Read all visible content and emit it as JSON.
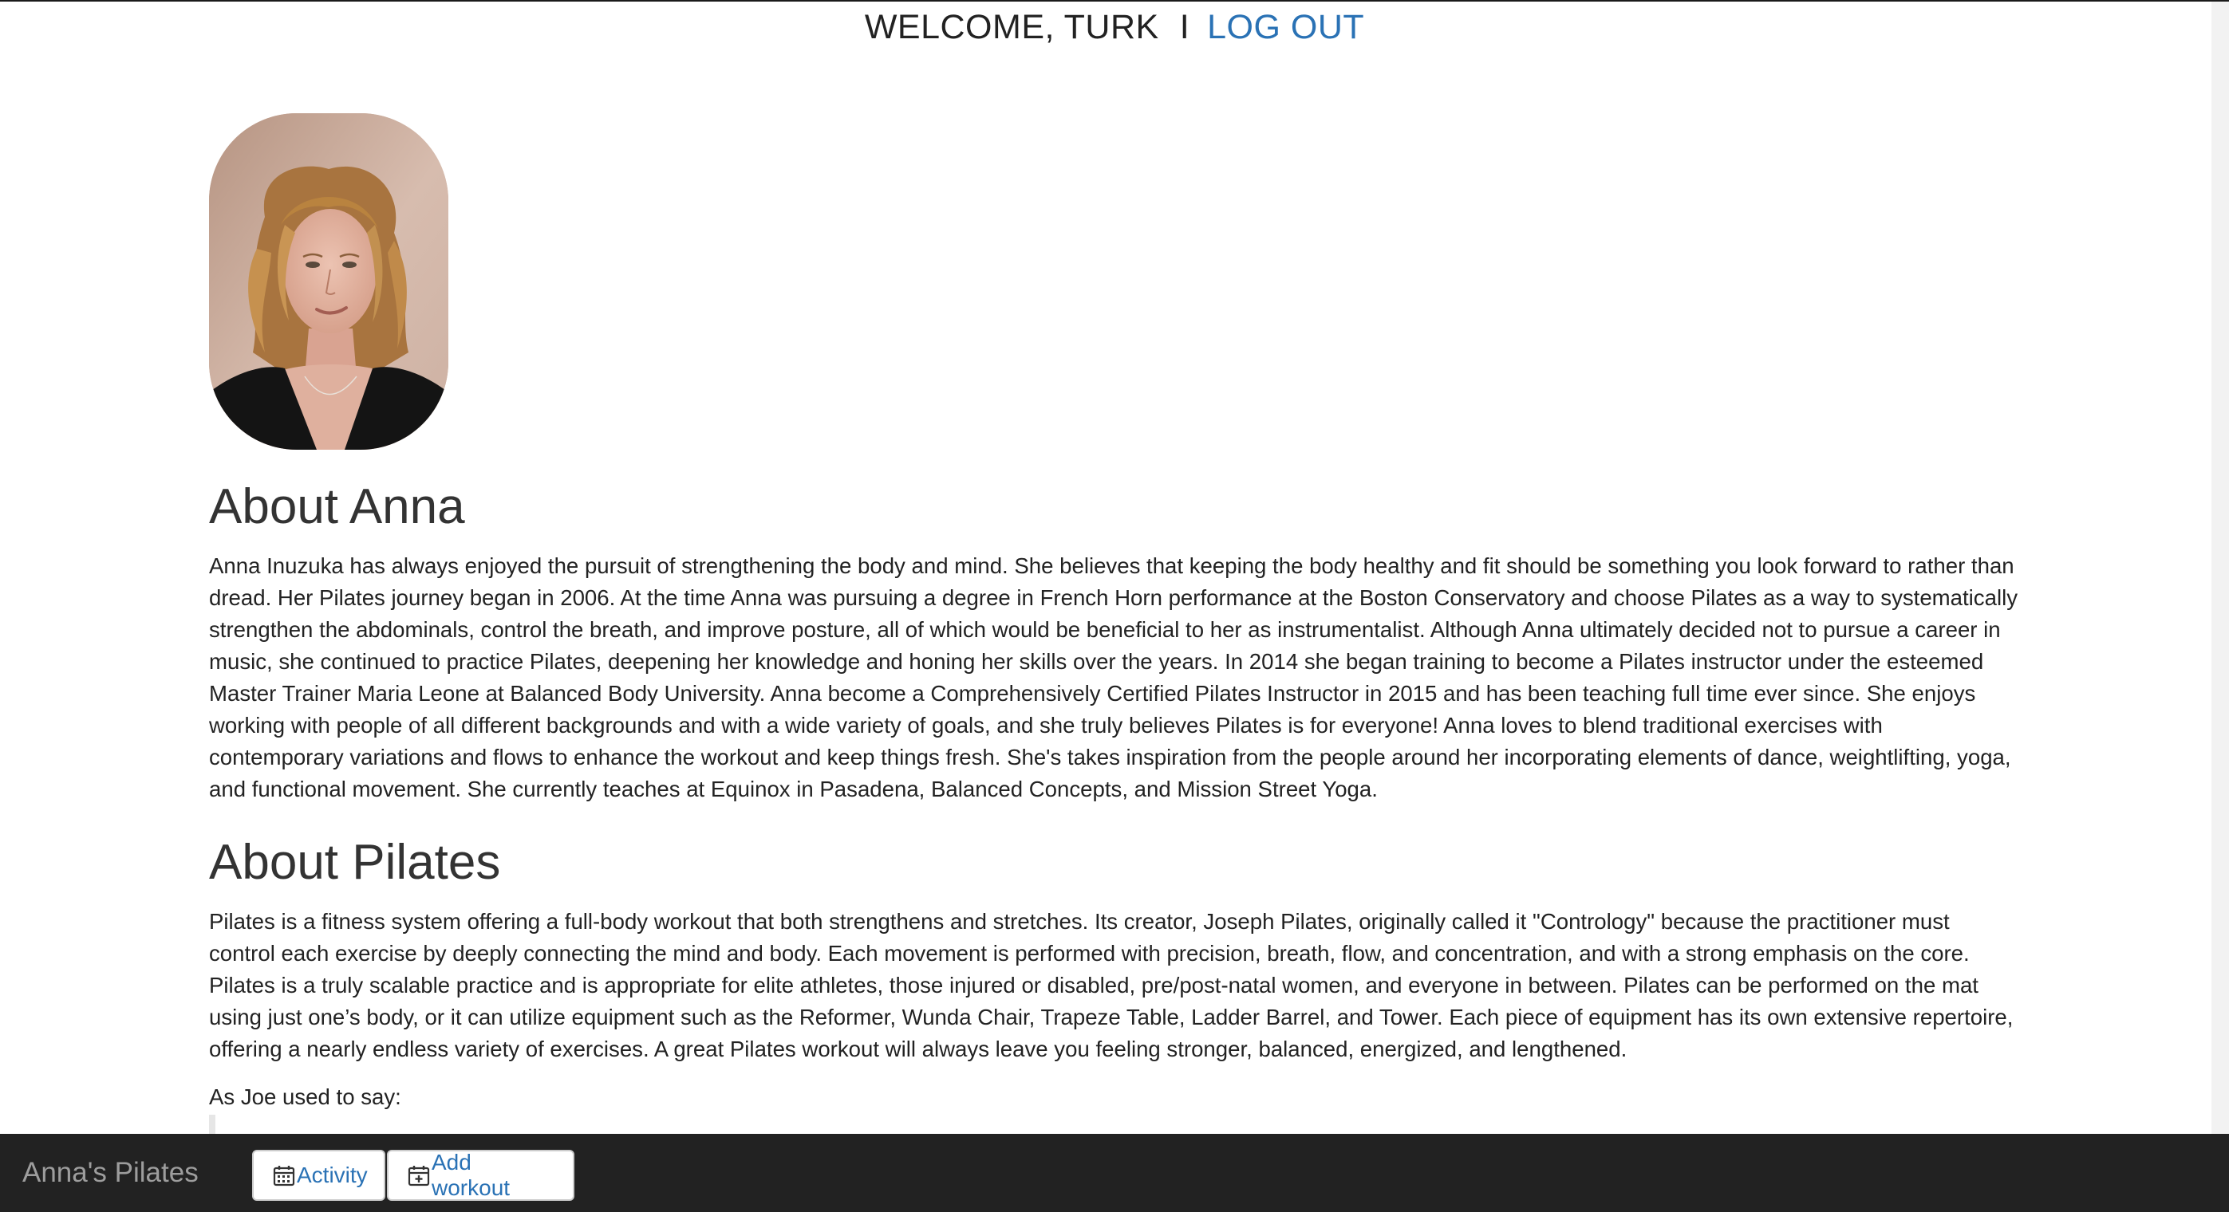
{
  "header": {
    "welcome_text": "WELCOME, TURK",
    "separator": "I",
    "logout_label": "LOG OUT"
  },
  "profile": {
    "photo_alt": "Anna"
  },
  "about_anna": {
    "heading": "About Anna",
    "body": "Anna Inuzuka has always enjoyed the pursuit of strengthening the body and mind. She believes that keeping the body healthy and fit should be something you look forward to rather than dread. Her Pilates journey began in 2006. At the time Anna was pursuing a degree in French Horn performance at the Boston Conservatory and choose Pilates as a way to systematically strengthen the abdominals, control the breath, and improve posture, all of which would be beneficial to her as instrumentalist. Although Anna ultimately decided not to pursue a career in music, she continued to practice Pilates, deepening her knowledge and honing her skills over the years. In 2014 she began training to become a Pilates instructor under the esteemed Master Trainer Maria Leone at Balanced Body University. Anna become a Comprehensively Certified Pilates Instructor in 2015 and has been teaching full time ever since. She enjoys working with people of all different backgrounds and with a wide variety of goals, and she truly believes Pilates is for everyone! Anna loves to blend traditional exercises with contemporary variations and flows to enhance the workout and keep things fresh. She's takes inspiration from the people around her incorporating elements of dance, weightlifting, yoga, and functional movement. She currently teaches at Equinox in Pasadena, Balanced Concepts, and Mission Street Yoga."
  },
  "about_pilates": {
    "heading": "About Pilates",
    "body": "Pilates is a fitness system offering a full-body workout that both strengthens and stretches. Its creator, Joseph Pilates, originally called it \"Contrology\" because the practitioner must control each exercise by deeply connecting the mind and body. Each movement is performed with precision, breath, flow, and concentration, and with a strong emphasis on the core. Pilates is a truly scalable practice and is appropriate for elite athletes, those injured or disabled, pre/post-natal women, and everyone in between. Pilates can be performed on the mat using just one’s body, or it can utilize equipment such as the Reformer, Wunda Chair, Trapeze Table, Ladder Barrel, and Tower. Each piece of equipment has its own extensive repertoire, offering a nearly endless variety of exercises. A great Pilates workout will always leave you feeling stronger, balanced, energized, and lengthened.",
    "quote_intro": "As Joe used to say:"
  },
  "navbar": {
    "brand": "Anna's Pilates",
    "activity_label": "Activity",
    "add_workout_label": "Add workout",
    "activity_icon": "calendar-icon",
    "add_workout_icon": "calendar-plus-icon"
  },
  "colors": {
    "link": "#2a72b5",
    "navbar_bg": "#222222",
    "brand_text": "#9d9d9d"
  }
}
